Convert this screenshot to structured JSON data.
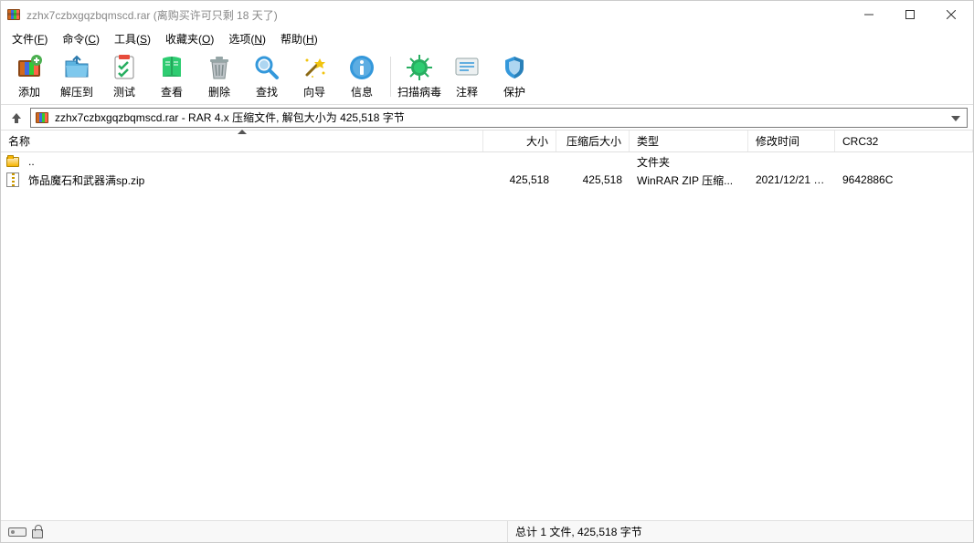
{
  "titlebar": {
    "title": "zzhx7czbxgqzbqmscd.rar (离购买许可只剩 18 天了)"
  },
  "menu": {
    "file": "文件(F)",
    "commands": "命令(C)",
    "tools": "工具(S)",
    "favorites": "收藏夹(O)",
    "options": "选项(N)",
    "help": "帮助(H)"
  },
  "toolbar": {
    "add": "添加",
    "extract": "解压到",
    "test": "测试",
    "view": "查看",
    "delete": "删除",
    "find": "查找",
    "wizard": "向导",
    "info": "信息",
    "virusscan": "扫描病毒",
    "comment": "注释",
    "protect": "保护"
  },
  "pathbar": {
    "text": "zzhx7czbxgqzbqmscd.rar - RAR 4.x 压缩文件, 解包大小为 425,518 字节"
  },
  "columns": {
    "name": "名称",
    "size": "大小",
    "packed": "压缩后大小",
    "type": "类型",
    "modified": "修改时间",
    "crc32": "CRC32"
  },
  "rows": [
    {
      "icon": "folder",
      "name": "..",
      "size": "",
      "packed": "",
      "type": "文件夹",
      "modified": "",
      "crc": ""
    },
    {
      "icon": "zip",
      "name": "饰品魔石和武器满sp.zip",
      "size": "425,518",
      "packed": "425,518",
      "type": "WinRAR ZIP 压缩...",
      "modified": "2021/12/21 9...",
      "crc": "9642886C"
    }
  ],
  "status": {
    "summary": "总计 1 文件, 425,518 字节"
  }
}
